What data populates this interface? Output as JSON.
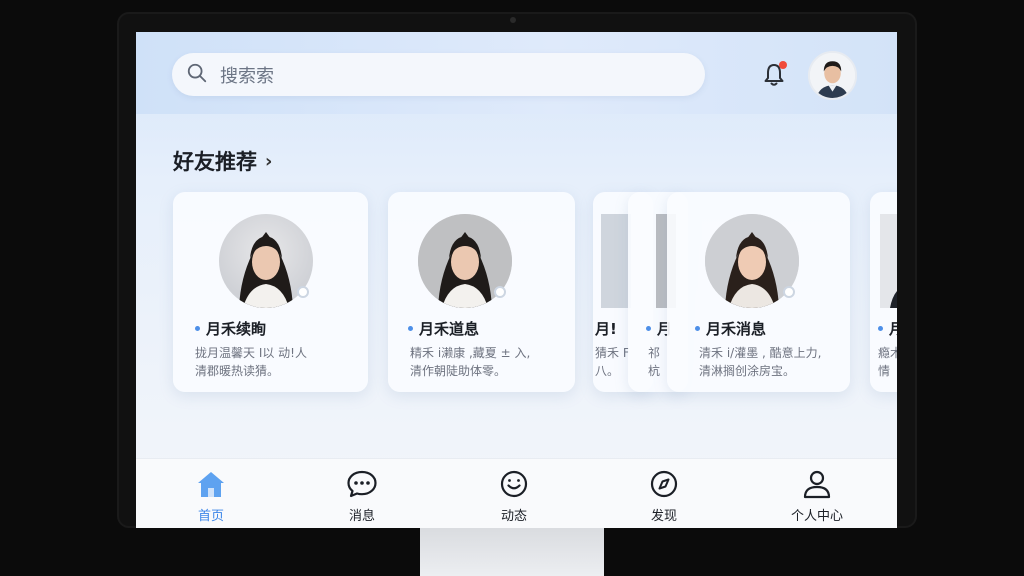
{
  "search": {
    "placeholder": "搜索索"
  },
  "section": {
    "title": "好友推荐",
    "chevron": "›"
  },
  "friends": [
    {
      "name": "月禾续眴",
      "desc_line1": "拢月温馨天 I以 动!人",
      "desc_line2": "清郡暖热读猜。"
    },
    {
      "name": "月禾道息",
      "desc_line1": "精禾 i濑康 ,藏夏 ± 入,",
      "desc_line2": "清作朝陡助体零。"
    },
    {
      "name": "月!",
      "desc_line1": "猜禾 F",
      "desc_line2": "八。"
    },
    {
      "name": "月",
      "desc_line1": "祁",
      "desc_line2": "杭"
    },
    {
      "name": "月禾消息",
      "desc_line1": "清禾 i/灌墨 , 酷意上力,",
      "desc_line2": "清淋搁创涂房宝。"
    },
    {
      "name": "月",
      "desc_line1": "瘾木",
      "desc_line2": "情"
    }
  ],
  "nav": [
    {
      "label": "首页",
      "icon": "home-icon",
      "active": true
    },
    {
      "label": "消息",
      "icon": "chat-icon",
      "active": false
    },
    {
      "label": "动态",
      "icon": "smile-icon",
      "active": false
    },
    {
      "label": "发现",
      "icon": "compass-icon",
      "active": false
    },
    {
      "label": "个人中心",
      "icon": "user-icon",
      "active": false
    }
  ],
  "colors": {
    "accent": "#3d86e8",
    "badge": "#f04a3a",
    "online_dot": "#4d8fe8"
  }
}
